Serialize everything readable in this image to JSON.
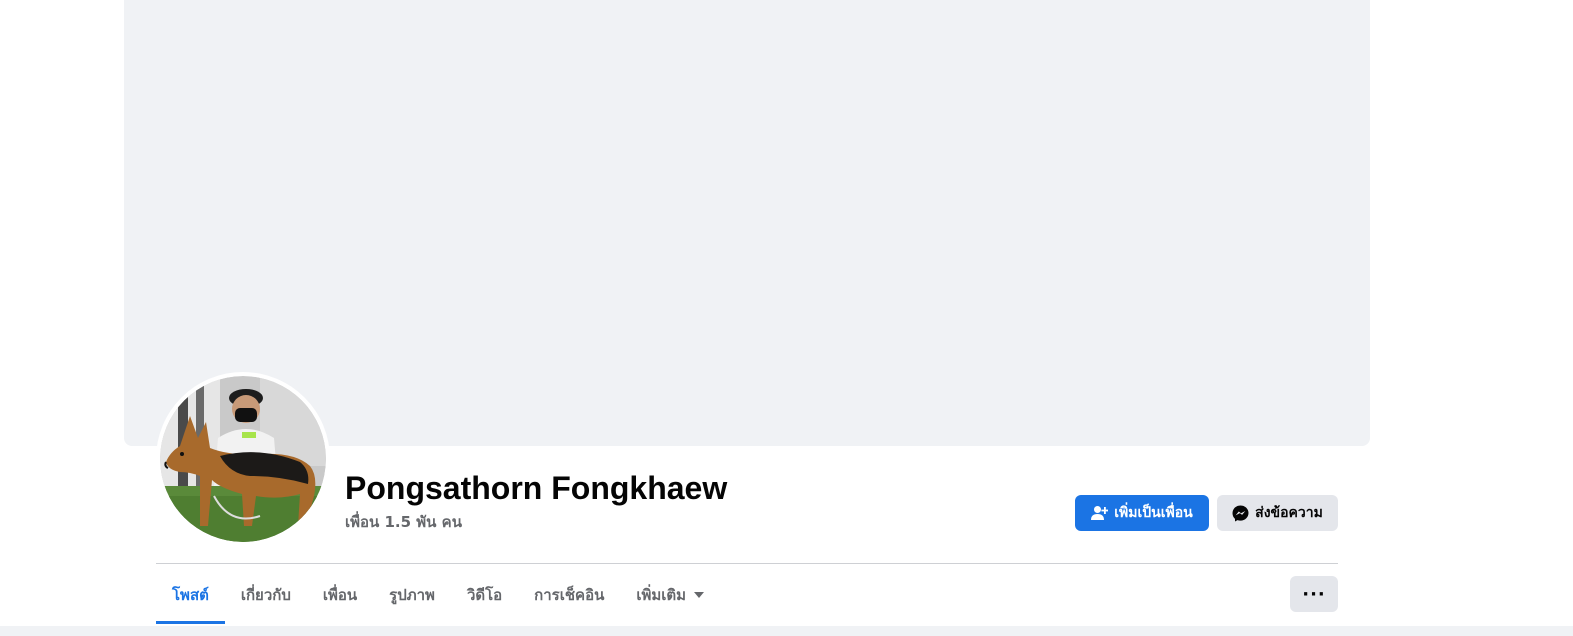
{
  "profile": {
    "name": "Pongsathorn Fongkhaew",
    "friends_count": "เพื่อน 1.5 พัน คน"
  },
  "actions": {
    "add_friend_label": "เพิ่มเป็นเพื่อน",
    "message_label": "ส่งข้อความ",
    "more_label": "···"
  },
  "tabs": [
    {
      "label": "โพสต์",
      "active": true
    },
    {
      "label": "เกี่ยวกับ",
      "active": false
    },
    {
      "label": "เพื่อน",
      "active": false
    },
    {
      "label": "รูปภาพ",
      "active": false
    },
    {
      "label": "วิดีโอ",
      "active": false
    },
    {
      "label": "การเช็คอิน",
      "active": false
    },
    {
      "label": "เพิ่มเติม",
      "active": false
    }
  ],
  "icons": {
    "add_friend": "person-add-icon",
    "message": "messenger-icon",
    "more_tab": "caret-down-icon",
    "more_button": "ellipsis-icon"
  },
  "colors": {
    "accent": "#1b74e4",
    "secondary_button": "#e4e6eb",
    "cover": "#f0f2f5",
    "muted_text": "#65676b"
  }
}
